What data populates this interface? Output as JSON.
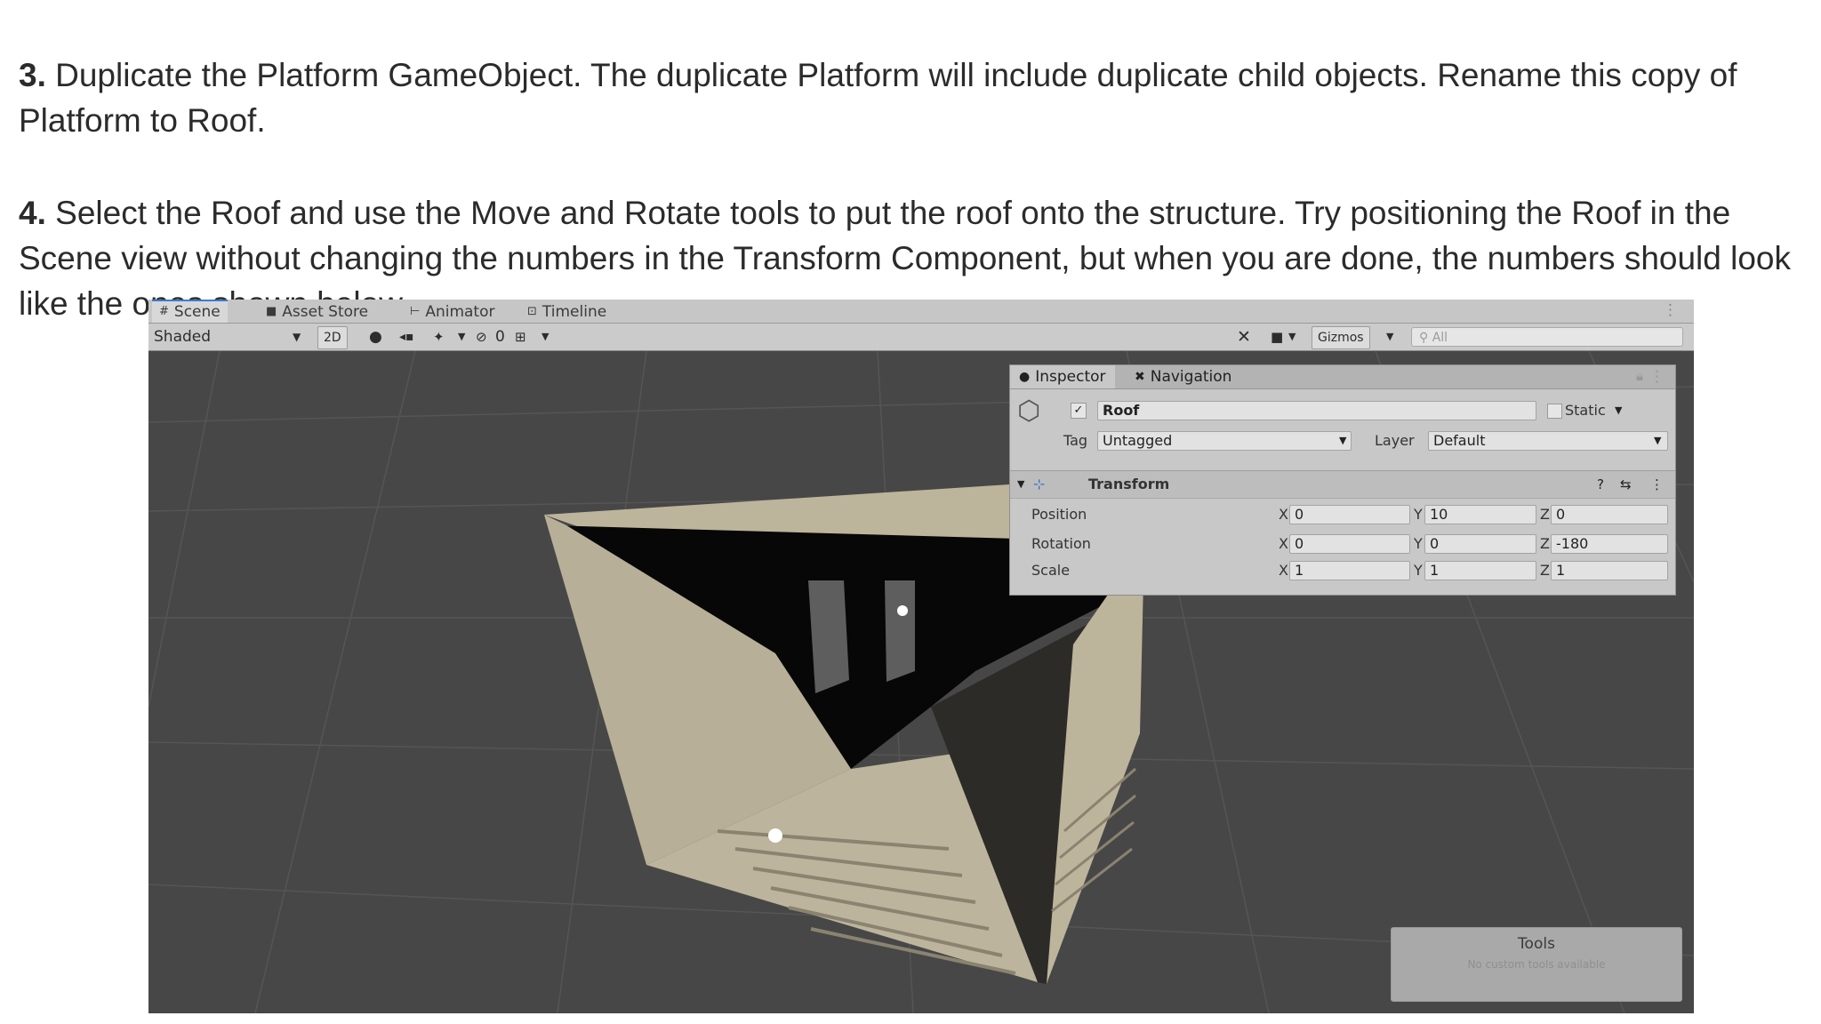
{
  "instructions": {
    "step3": {
      "number": "3.",
      "text": " Duplicate the Platform GameObject. The duplicate Platform will include duplicate child objects. Rename this copy of Platform to Roof."
    },
    "step4": {
      "number": "4.",
      "text": " Select the Roof and use the Move and Rotate tools to put the roof onto the structure. Try positioning the Roof in the Scene view without changing the numbers in the Transform Component, but when you are done, the numbers should look like the ones shown below."
    }
  },
  "editor": {
    "tabs": [
      {
        "label": "Scene",
        "icon": "grid-icon"
      },
      {
        "label": "Asset Store",
        "icon": "store-icon"
      },
      {
        "label": "Animator",
        "icon": "animator-icon"
      },
      {
        "label": "Timeline",
        "icon": "timeline-icon"
      }
    ],
    "toolbar": {
      "shading_mode": "Shaded",
      "mode_2d": "2D",
      "hidden_count": "0",
      "gizmos": "Gizmos",
      "search_placeholder": "All"
    },
    "inspector": {
      "tabs": [
        {
          "label": "Inspector",
          "icon": "info-icon"
        },
        {
          "label": "Navigation",
          "icon": "navigation-icon"
        }
      ],
      "object_name": "Roof",
      "static_label": "Static",
      "tag_label": "Tag",
      "tag_value": "Untagged",
      "layer_label": "Layer",
      "layer_value": "Default",
      "component": "Transform",
      "rows": [
        {
          "label": "Position",
          "x": "0",
          "y": "10",
          "z": "0"
        },
        {
          "label": "Rotation",
          "x": "0",
          "y": "0",
          "z": "-180"
        },
        {
          "label": "Scale",
          "x": "1",
          "y": "1",
          "z": "1"
        }
      ],
      "axes": {
        "x": "X",
        "y": "Y",
        "z": "Z"
      }
    },
    "tools_overlay": {
      "title": "Tools",
      "subtitle": "No custom tools available"
    }
  }
}
